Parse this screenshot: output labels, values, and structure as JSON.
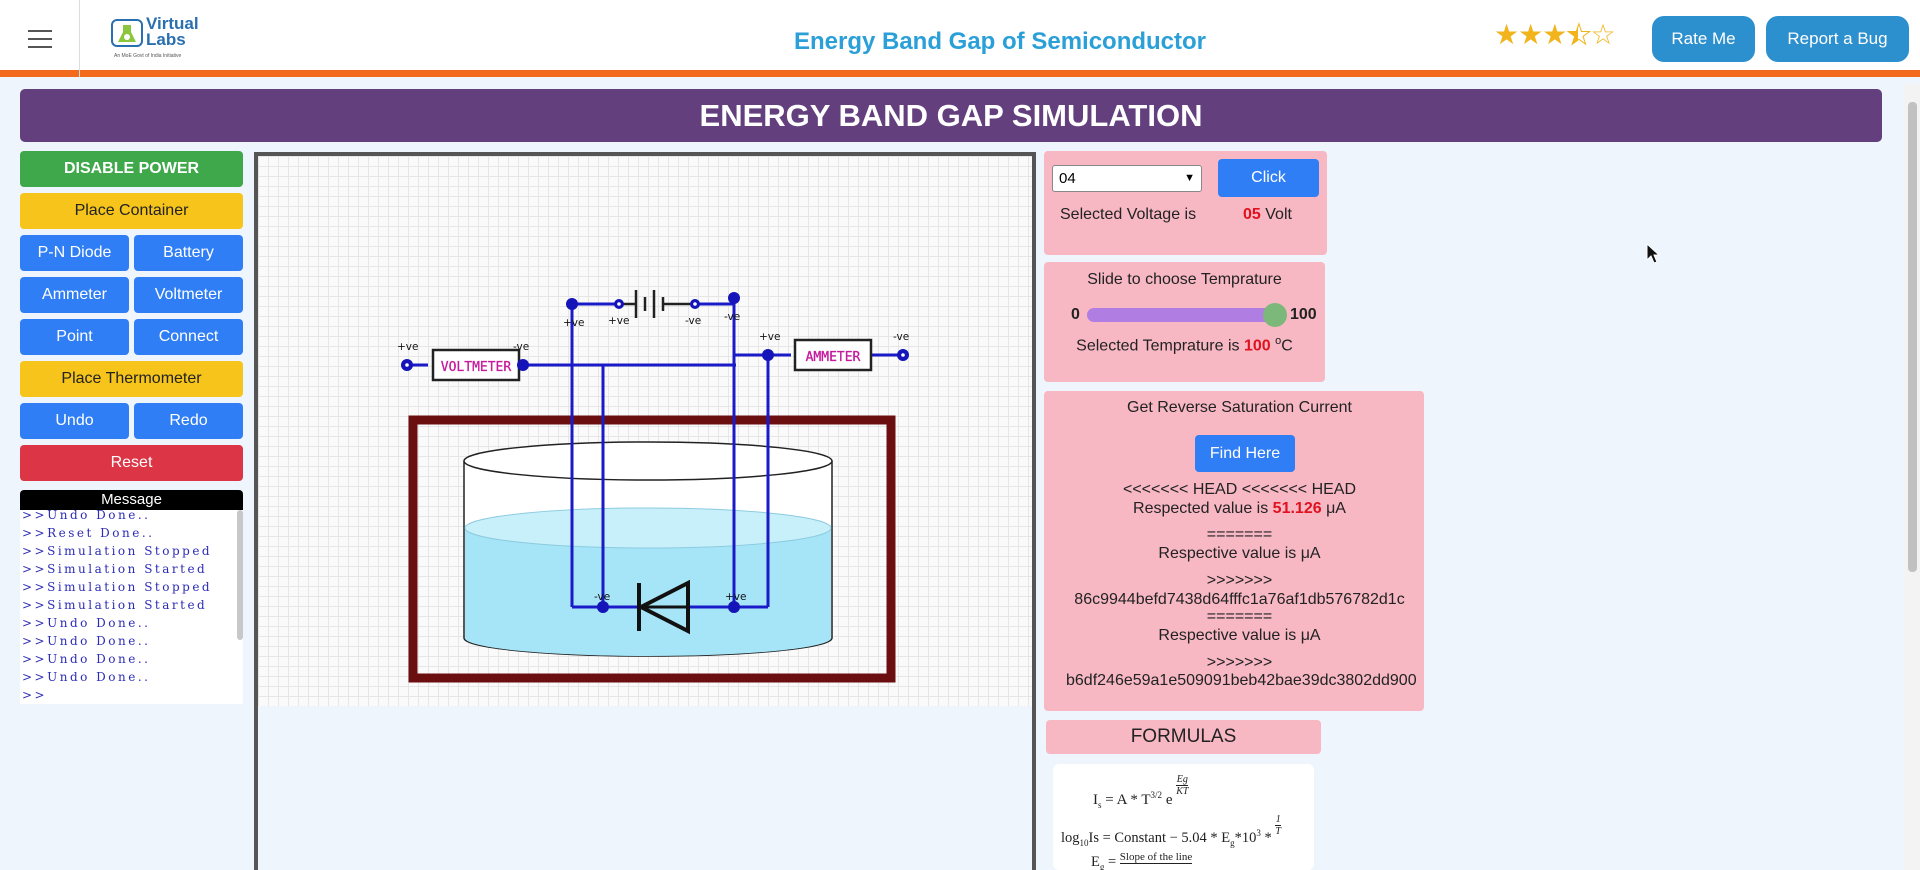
{
  "header": {
    "logo_text": "Virtual Labs",
    "logo_tagline": "An MoE Govt of India Initiative",
    "title": "Energy Band Gap of Semiconductor",
    "rating": 3.5,
    "rate_label": "Rate Me",
    "bug_label": "Report a Bug"
  },
  "banner": {
    "title": "ENERGY BAND GAP SIMULATION"
  },
  "controls": {
    "disable_power": "DISABLE POWER",
    "place_container": "Place Container",
    "pn_diode": "P-N Diode",
    "battery": "Battery",
    "ammeter": "Ammeter",
    "voltmeter": "Voltmeter",
    "point": "Point",
    "connect": "Connect",
    "place_thermometer": "Place Thermometer",
    "undo": "Undo",
    "redo": "Redo",
    "reset": "Reset"
  },
  "message": {
    "title": "Message",
    "lines": [
      ">>Undo Done..",
      ">>Reset Done..",
      ">>Simulation Stopped",
      ">>Simulation Started",
      ">>Simulation Stopped",
      ">>Simulation Started",
      ">>Undo Done..",
      ">>Undo Done..",
      ">>Undo Done..",
      ">>Undo Done..",
      ">>"
    ]
  },
  "circuit": {
    "voltmeter_label": "VOLTMETER",
    "ammeter_label": "AMMETER",
    "plus": "+ve",
    "minus": "-ve"
  },
  "voltage": {
    "selected_option": "04",
    "click_label": "Click",
    "label": "Selected Voltage is",
    "value": "05",
    "unit": "Volt"
  },
  "temperature": {
    "title": "Slide to choose Temprature",
    "min": "0",
    "max": "100",
    "slider_value": 100,
    "label": "Selected Temprature is",
    "value": "100",
    "unit_sup": "o",
    "unit": "C"
  },
  "saturation": {
    "title": "Get Reverse Saturation Current",
    "find_label": "Find Here",
    "head_line": "<<<<<<< HEAD <<<<<<< HEAD",
    "respected_label": "Respected value is",
    "respected_value": "51.126",
    "unit": "μA",
    "sep1": "=======",
    "respective_label_1": "Respective value is  μA",
    "marker1": ">>>>>>>",
    "hash1": "86c9944befd7438d64fffc1a76af1db576782d1c",
    "sep2": "=======",
    "respective_label_2": "Respective value is  μA",
    "marker2": ">>>>>>>",
    "hash2": "b6df246e59a1e509091beb42bae39dc3802dd900"
  },
  "formulas": {
    "title": "FORMULAS",
    "f1_lhs": "I",
    "f1_sub": "s",
    "f1_rhs": " = A * T",
    "f1_exp": "3/2",
    "f1_e": " e ",
    "f1_num": "Eg",
    "f1_den": "KT",
    "f2_lhs": "log",
    "f2_sub": "10",
    "f2_rhs": "Is = Constant − 5.04 * E",
    "f2_sub2": "g",
    "f2_tail": "*10",
    "f2_exp": "3",
    "f2_mult": " *",
    "f2_num": "1",
    "f2_den": "T",
    "f3_lhs": "E",
    "f3_sub": "g",
    "f3_eq": " = ",
    "f3_num": "Slope of the line"
  },
  "colors": {
    "header_accent": "#f26a1b",
    "banner_bg": "#633f7e",
    "panel_bg": "#f7b8c4",
    "wire": "#1a1ac8",
    "container": "#6b0e10",
    "water": "#a6e4f7"
  }
}
